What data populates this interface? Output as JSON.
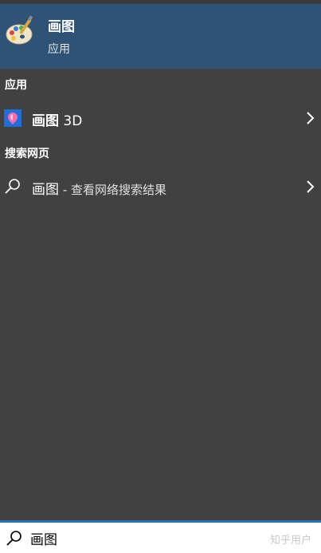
{
  "best_match": {
    "title": "画图",
    "subtitle": "应用"
  },
  "sections": {
    "apps_header": "应用",
    "web_header": "搜索网页"
  },
  "apps": {
    "paint3d": {
      "name_bold": "画图",
      "name_rest": " 3D"
    }
  },
  "web": {
    "query": "画图",
    "hint": " - 查看网络搜索结果"
  },
  "search": {
    "value": "画图",
    "watermark": "知乎用户"
  },
  "colors": {
    "panel_bg": "#414141",
    "selected_bg": "#2f5376",
    "accent": "#2b74b9"
  },
  "icons": {
    "best_match": "paint-palette-icon",
    "app": "paint-3d-icon",
    "web": "search-icon",
    "chevron": "chevron-right-icon",
    "searchbar": "search-icon"
  }
}
